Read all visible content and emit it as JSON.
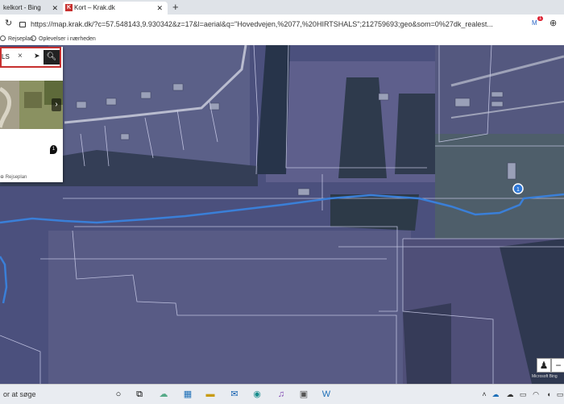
{
  "browser": {
    "tabs": [
      {
        "label": "kelkort - Bing"
      },
      {
        "label": "Kort – Krak.dk"
      }
    ],
    "address": {
      "url": "https://map.krak.dk/?c=57.548143,9.930342&z=17&l=aerial&q=\"Hovedvejen,%2077,%20HIRTSHALS\";212759693;geo&som=0%27dk_realest..."
    },
    "bookmarks": [
      {
        "label": "Rejseplan"
      },
      {
        "label": "Oplevelser i nærheden"
      }
    ],
    "extension_badge": "1"
  },
  "map": {
    "search": {
      "value": "LS"
    },
    "result_marker": "1",
    "panel_link": "Rejseplan",
    "credit": "Microsoft Bing"
  },
  "taskbar": {
    "search_placeholder": "or at søge"
  }
}
